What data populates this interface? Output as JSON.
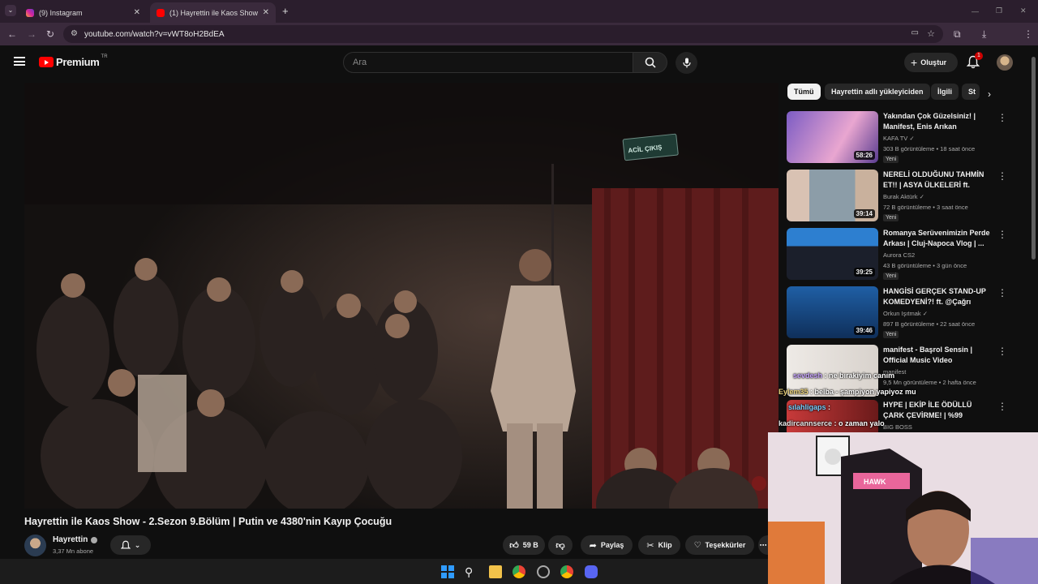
{
  "browser": {
    "tabs": [
      {
        "title": "(9) Instagram",
        "active": false
      },
      {
        "title": "(1) Hayrettin ile Kaos Show - 2.S",
        "active": true
      }
    ],
    "new_tab": "+",
    "url": "youtube.com/watch?v=vWT8oH2BdEA"
  },
  "youtube": {
    "logo_text": "Premium",
    "logo_region": "TR",
    "search_placeholder": "Ara",
    "create_label": "Oluştur",
    "notifications_count": "1"
  },
  "video": {
    "title": "Hayrettin ile Kaos Show - 2.Sezon 9.Bölüm | Putin ve 4380'nin Kayıp Çocuğu",
    "channel": "Hayrettin",
    "subscribers": "3,37 Mn abone",
    "likes": "59 B",
    "share_label": "Paylaş",
    "clip_label": "Klip",
    "thanks_label": "Teşekkürler",
    "exit_sign": "ACİL ÇIKIŞ"
  },
  "chips": [
    "Tümü",
    "Hayrettin adlı yükleyiciden",
    "İlgili",
    "St"
  ],
  "recommendations": [
    {
      "title": "Yakından Çok Güzelsiniz! | Manifest, Enis Arıkan",
      "channel": "KAFA TV",
      "meta": "303 B görüntüleme • 18 saat önce",
      "badge": "Yeni",
      "duration": "58:26",
      "thumb_color": "#6a4aa8"
    },
    {
      "title": "NERELİ OLDUĞUNU TAHMİN ET!! | ASYA ÜLKELERİ ft. (Emr...",
      "channel": "Burak Aktürk",
      "meta": "72 B görüntüleme • 3 saat önce",
      "badge": "Yeni",
      "duration": "39:14",
      "thumb_color": "#b8b6b2"
    },
    {
      "title": "Romanya Serüvenimizin Perde Arkası | Cluj-Napoca Vlog | ...",
      "channel": "Aurora CS2",
      "meta": "43 B görüntüleme • 3 gün önce",
      "badge": "Yeni",
      "duration": "39:25",
      "thumb_color": "#2a6fb5"
    },
    {
      "title": "HANGİSİ GERÇEK STAND-UP KOMEDYENİ?! ft. @Çağrı Ergün",
      "channel": "Orkun Işıtmak",
      "meta": "897 B görüntüleme • 22 saat önce",
      "badge": "Yeni",
      "duration": "39:46",
      "thumb_color": "#1f4f8a"
    },
    {
      "title": "manifest - Başrol Sensin | Official Music Video",
      "channel": "manifest",
      "meta": "9,5 Mn görüntüleme • 2 hafta önce",
      "badge": "",
      "duration": "",
      "thumb_color": "#e6e2df"
    },
    {
      "title": "HYPE | EKİP İLE ÖDÜLLÜ ÇARK ÇEVİRME! | %99 İMPOSSİBLE",
      "channel": "BIG BOSS",
      "meta": "",
      "badge": "",
      "duration": "",
      "thumb_color": "#c83a3a"
    }
  ],
  "chat": [
    {
      "user": "sevdesh",
      "message": "ne bırakiyim canım"
    },
    {
      "user": "Eylem35",
      "message": "belba - şampiyon yapiyoz mu"
    },
    {
      "user": "sılahligaps",
      "message": ""
    },
    {
      "user": "kadircannserce",
      "message": "o zaman yalo"
    }
  ],
  "webcam": {
    "chair_brand": "HAWK"
  },
  "colors": {
    "accent_red": "#ff0000",
    "browser_tab_bar": "#2b1e2d",
    "background": "#0f0f0f"
  }
}
